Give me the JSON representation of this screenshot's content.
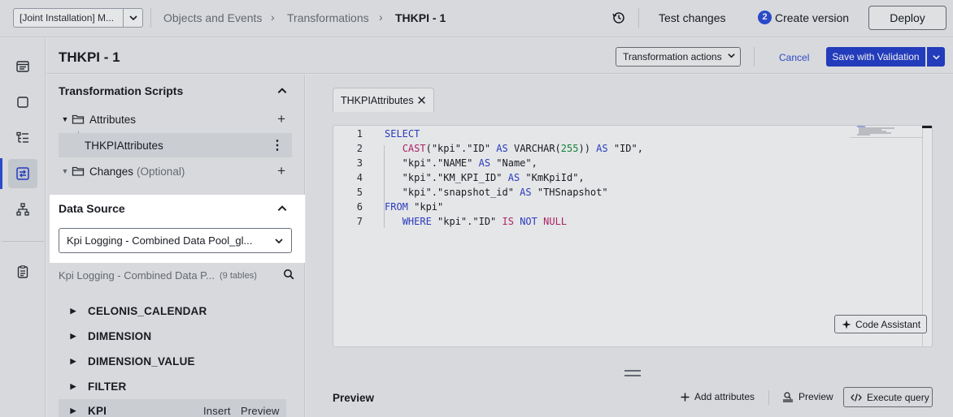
{
  "topbar": {
    "workspace": "[Joint Installation] M...",
    "breadcrumbs": [
      "Objects and Events",
      "Transformations",
      "THKPI - 1"
    ],
    "test_changes": "Test changes",
    "version_badge": "2",
    "create_version": "Create version",
    "deploy": "Deploy"
  },
  "header": {
    "title": "THKPI - 1",
    "transformation_actions": "Transformation actions",
    "cancel": "Cancel",
    "save": "Save with Validation"
  },
  "scripts": {
    "title": "Transformation Scripts",
    "attributes": "Attributes",
    "attributes_child": "THKPIAttributes",
    "changes": "Changes",
    "changes_optional": "(Optional)"
  },
  "datasource": {
    "title": "Data Source",
    "selected": "Kpi Logging - Combined Data Pool_gl...",
    "pool_name": "Kpi Logging - Combined Data P...",
    "table_count": "(9 tables)",
    "tables": [
      "CELONIS_CALENDAR",
      "DIMENSION",
      "DIMENSION_VALUE",
      "FILTER",
      "KPI"
    ],
    "row_insert": "Insert",
    "row_preview": "Preview"
  },
  "editor": {
    "tab": "THKPIAttributes",
    "line_numbers": [
      "1",
      "2",
      "3",
      "4",
      "5",
      "6",
      "7"
    ],
    "code_assistant": "Code Assistant"
  },
  "preview": {
    "label": "Preview",
    "add_attributes": "Add attributes",
    "preview_btn": "Preview",
    "execute": "Execute query"
  },
  "colors": {
    "accent": "#2540c8",
    "keyword": "#2d3fc8",
    "function": "#b5266b",
    "number": "#168a3e"
  }
}
